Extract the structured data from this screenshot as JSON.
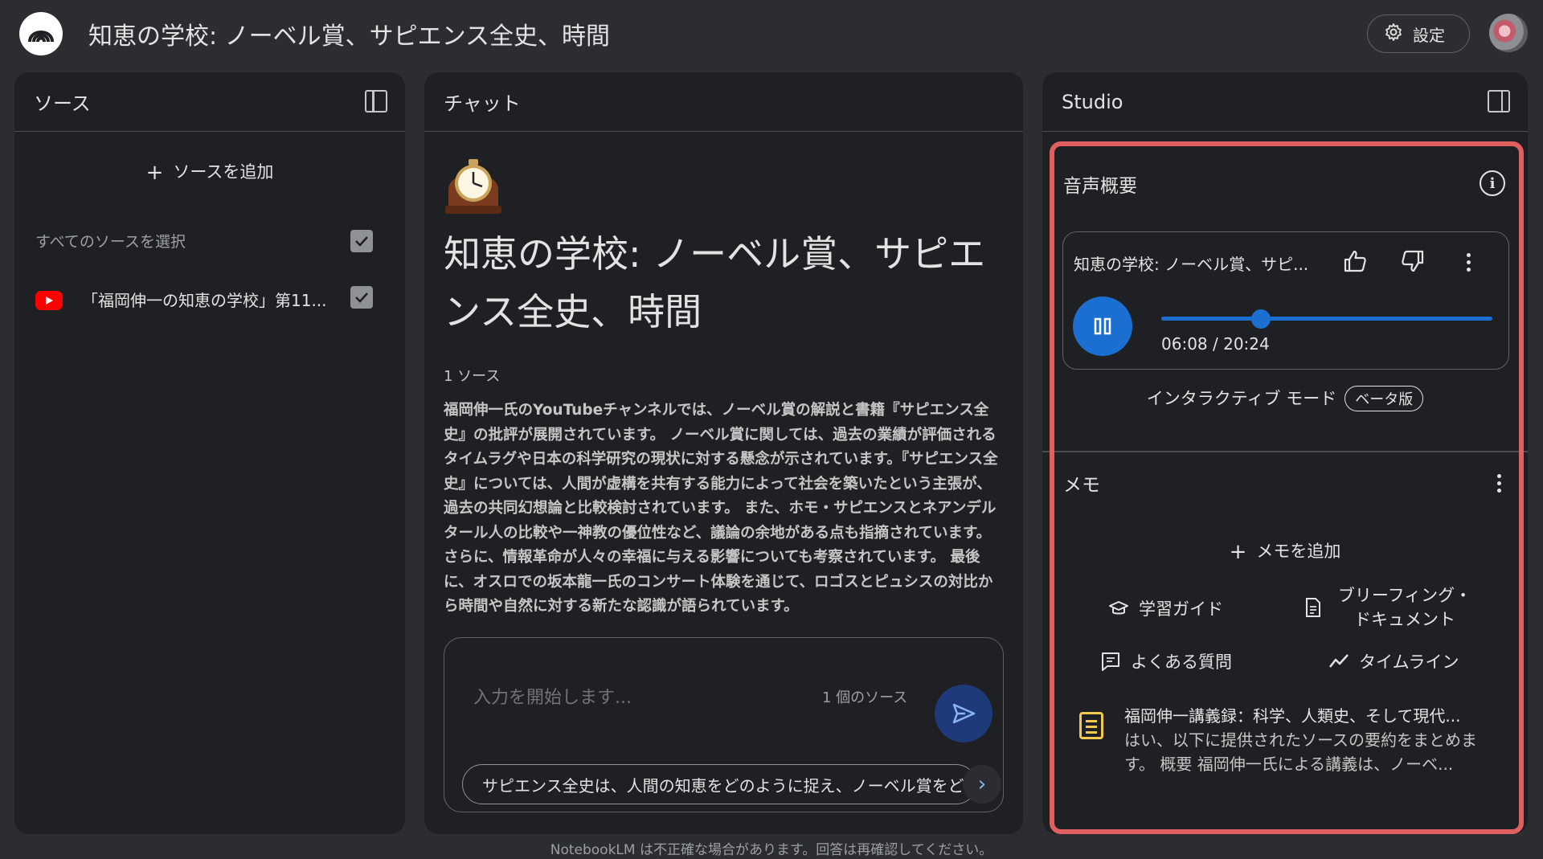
{
  "header": {
    "title": "知恵の学校: ノーベル賞、サピエンス全史、時間",
    "settings_label": "設定",
    "logo_icon": "notebooklm-logo-icon",
    "avatar": "user-avatar"
  },
  "sources": {
    "title": "ソース",
    "add_label": "ソースを追加",
    "select_all_label": "すべてのソースを選択",
    "items": [
      {
        "label": "「福岡伸一の知恵の学校」第11...",
        "icon": "youtube-icon",
        "checked": true
      }
    ]
  },
  "chat": {
    "title": "チャット",
    "notebook_emoji": "mantel-clock",
    "notebook_title": "知恵の学校: ノーベル賞、サピエンス全史、時間",
    "source_count": "1 ソース",
    "summary": "福岡伸一氏のYouTubeチャンネルでは、ノーベル賞の解説と書籍『サピエンス全史』の批評が展開されています。 ノーベル賞に関しては、過去の業績が評価されるタイムラグや日本の科学研究の現状に対する懸念が示されています。『サピエンス全史』については、人間が虚構を共有する能力によって社会を築いたという主張が、過去の共同幻想論と比較検討されています。 また、ホモ・サピエンスとネアンデルタール人の比較や一神教の優位性など、議論の余地がある点も指摘されています。 さらに、情報革命が人々の幸福に与える影響についても考察されています。 最後に、オスロでの坂本龍一氏のコンサート体験を通じて、ロゴスとピュシスの対比から時間や自然に対する新たな認識が語られています。",
    "input_placeholder": "入力を開始します...",
    "input_source_count": "1 個のソース",
    "suggestion": "サピエンス全史は、人間の知恵をどのように捉え、ノーベル賞をどう評価するか？",
    "footer": "NotebookLM は不正確な場合があります。回答は再確認してください。"
  },
  "studio": {
    "title": "Studio",
    "audio": {
      "section_title": "音声概要",
      "card_title": "知恵の学校: ノーベル賞、サピ...",
      "current_time": "06:08",
      "total_time": "20:24",
      "time_display": "06:08 / 20:24",
      "progress": 0.3,
      "interactive_mode_label": "インタラクティブ モード",
      "beta_label": "ベータ版"
    },
    "memo": {
      "section_title": "メモ",
      "add_label": "メモを追加",
      "tools": [
        {
          "label": "学習ガイド",
          "icon": "graduation-cap-icon"
        },
        {
          "label": "ブリーフィング・ドキュメント",
          "icon": "document-icon"
        },
        {
          "label": "よくある質問",
          "icon": "faq-icon"
        },
        {
          "label": "タイムライン",
          "icon": "timeline-icon"
        }
      ],
      "items": [
        {
          "title": "福岡伸一講義録：科学、人類史、そして現代...",
          "preview": "はい、以下に提供されたソースの要約をまとめます。 概要 福岡伸一氏による講義は、ノーベ...",
          "icon": "note-icon"
        }
      ]
    },
    "highlight_color": "#e06060"
  },
  "colors": {
    "background": "#2b2d31",
    "panel": "#1f2023",
    "accent": "#1a6fd1",
    "youtube": "#ff0000",
    "note": "#f2c94c"
  }
}
